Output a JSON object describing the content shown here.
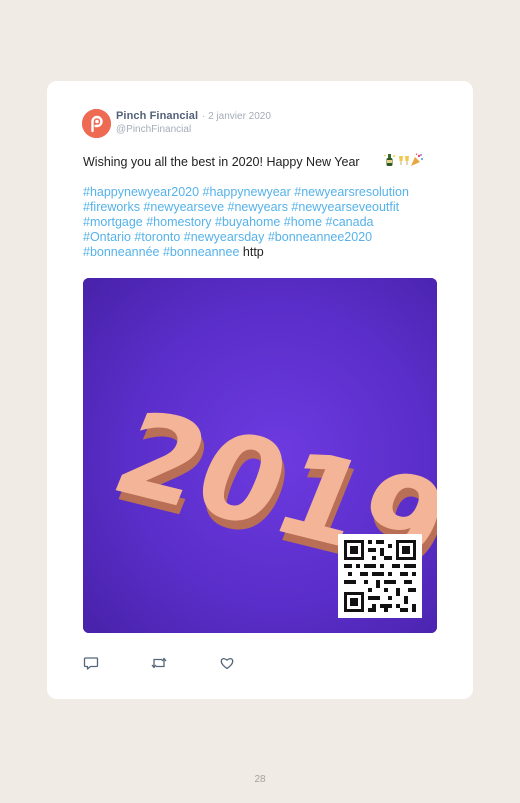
{
  "post": {
    "author_name": "Pinch Financial",
    "date": "· 2 janvier 2020",
    "handle": "@PinchFinancial",
    "text": "Wishing you all the best in 2020! Happy New Year",
    "hashtag_lines": [
      "#happynewyear2020 #happynewyear #newyearsresolution",
      "#fireworks #newyearseve #newyears #newyearseveoutfit",
      "#mortgage #homestory #buyahome #home #canada",
      "#Ontario #toronto #newyearsday #bonneannee2020"
    ],
    "last_line_tags": "#bonneannée #bonneannee",
    "last_line_link": "http",
    "image_text": "2019",
    "colors": {
      "hashtag": "#55b2ea",
      "avatar": "#ef6a53",
      "image_bg": "#5a2ec9",
      "numbers": "#f3b497"
    }
  },
  "actions": {
    "reply_icon": "reply-icon",
    "retweet_icon": "retweet-icon",
    "like_icon": "heart-icon"
  },
  "footer": {
    "page_number": "28"
  }
}
